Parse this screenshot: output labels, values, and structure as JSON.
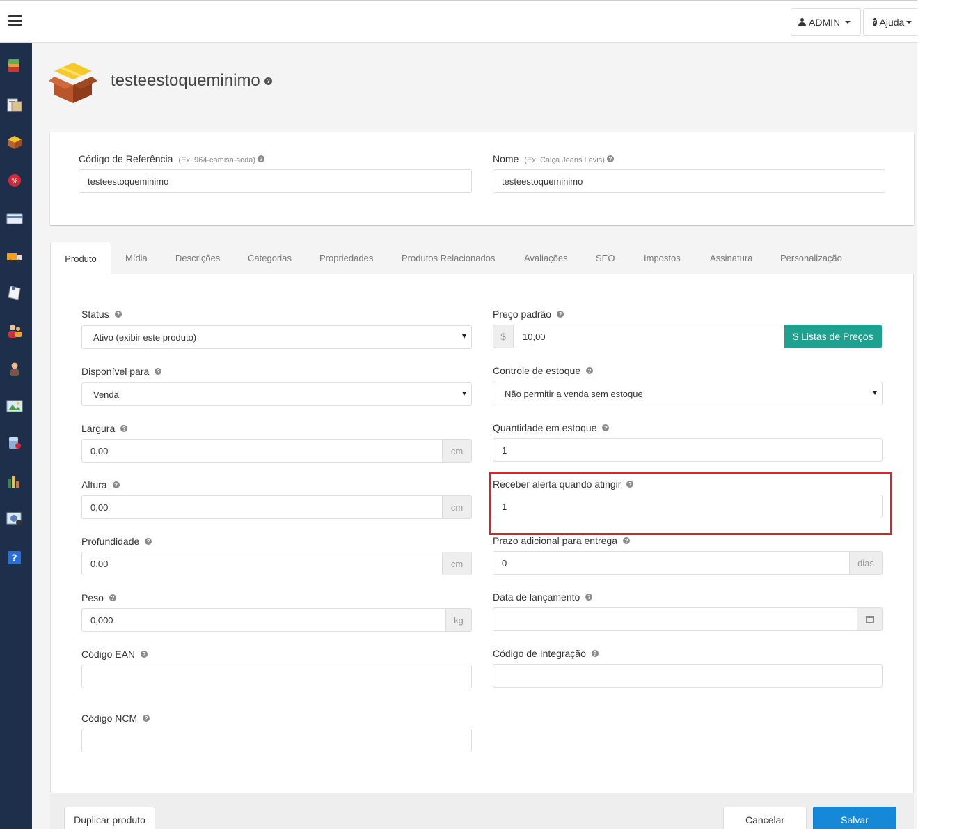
{
  "topbar": {
    "user_label": "ADMIN",
    "help_label": "Ajuda"
  },
  "sidebar": {
    "items": [
      {
        "icon": "stack-icon"
      },
      {
        "icon": "pages-icon"
      },
      {
        "icon": "box-icon"
      },
      {
        "icon": "discount-icon"
      },
      {
        "icon": "card-icon"
      },
      {
        "icon": "truck-icon"
      },
      {
        "icon": "document-icon"
      },
      {
        "icon": "users-icon"
      },
      {
        "icon": "user-icon"
      },
      {
        "icon": "image-icon"
      },
      {
        "icon": "database-icon"
      },
      {
        "icon": "chart-icon"
      },
      {
        "icon": "photo-icon"
      },
      {
        "icon": "help-icon"
      }
    ]
  },
  "header": {
    "title": "testeestoqueminimo"
  },
  "top_form": {
    "ref_label": "Código de Referência",
    "ref_hint": "(Ex: 964-camisa-seda)",
    "ref_value": "testeestoqueminimo",
    "name_label": "Nome",
    "name_hint": "(Ex: Calça Jeans Levis)",
    "name_value": "testeestoqueminimo"
  },
  "tabs": [
    {
      "label": "Produto",
      "active": true
    },
    {
      "label": "Mídia"
    },
    {
      "label": "Descrições"
    },
    {
      "label": "Categorias"
    },
    {
      "label": "Propriedades"
    },
    {
      "label": "Produtos Relacionados"
    },
    {
      "label": "Avaliações"
    },
    {
      "label": "SEO"
    },
    {
      "label": "Impostos"
    },
    {
      "label": "Assinatura"
    },
    {
      "label": "Personalização"
    }
  ],
  "form": {
    "status": {
      "label": "Status",
      "value": "Ativo (exibir este produto)"
    },
    "disponivel": {
      "label": "Disponível para",
      "value": "Venda"
    },
    "largura": {
      "label": "Largura",
      "value": "0,00",
      "unit": "cm"
    },
    "altura": {
      "label": "Altura",
      "value": "0,00",
      "unit": "cm"
    },
    "profundidade": {
      "label": "Profundidade",
      "value": "0,00",
      "unit": "cm"
    },
    "peso": {
      "label": "Peso",
      "value": "0,000",
      "unit": "kg"
    },
    "ean": {
      "label": "Código EAN",
      "value": ""
    },
    "ncm": {
      "label": "Código NCM",
      "value": ""
    },
    "preco": {
      "label": "Preço padrão",
      "currency": "$",
      "value": "10,00",
      "button": "$ Listas de Preços"
    },
    "controle": {
      "label": "Controle de estoque",
      "value": "Não permitir a venda sem estoque"
    },
    "quantidade": {
      "label": "Quantidade em estoque",
      "value": "1"
    },
    "alerta": {
      "label": "Receber alerta quando atingir",
      "value": "1"
    },
    "prazo": {
      "label": "Prazo adicional para entrega",
      "value": "0",
      "unit": "dias"
    },
    "lancamento": {
      "label": "Data de lançamento",
      "value": ""
    },
    "integracao": {
      "label": "Código de Integração",
      "value": ""
    }
  },
  "footer": {
    "duplicate": "Duplicar produto",
    "cancel": "Cancelar",
    "save": "Salvar"
  },
  "colors": {
    "sidebar": "#1d2f4b",
    "accent_teal": "#1fa18f",
    "primary_blue": "#1588d8",
    "highlight_red": "#e0202a"
  }
}
